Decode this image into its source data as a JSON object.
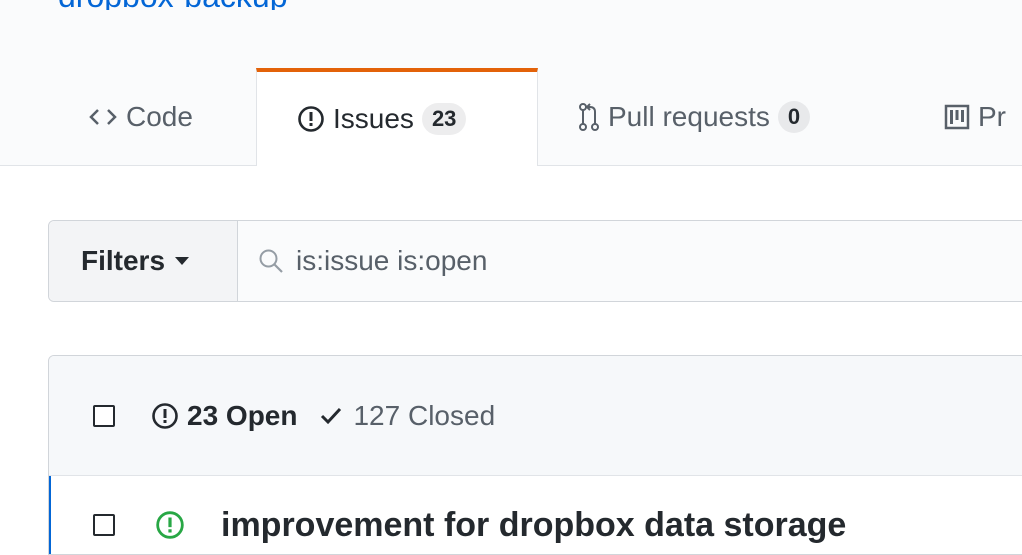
{
  "repo_fragment": "dropbox-backup",
  "tabs": {
    "code": {
      "label": "Code",
      "icon": "code-icon"
    },
    "issues": {
      "label": "Issues",
      "count": "23",
      "icon": "issue-opened-icon",
      "selected": true
    },
    "pulls": {
      "label": "Pull requests",
      "count": "0",
      "icon": "git-pull-request-icon"
    },
    "projects": {
      "label": "Pr",
      "icon": "project-icon"
    }
  },
  "filters": {
    "button_label": "Filters",
    "search_value": "is:issue is:open"
  },
  "issues_header": {
    "open_label": "23 Open",
    "closed_label": "127 Closed"
  },
  "issues": [
    {
      "title": "improvement for dropbox data storage",
      "status": "open"
    }
  ],
  "colors": {
    "accent_tab": "#e36209",
    "link": "#0366d6",
    "open_green": "#28a745"
  }
}
